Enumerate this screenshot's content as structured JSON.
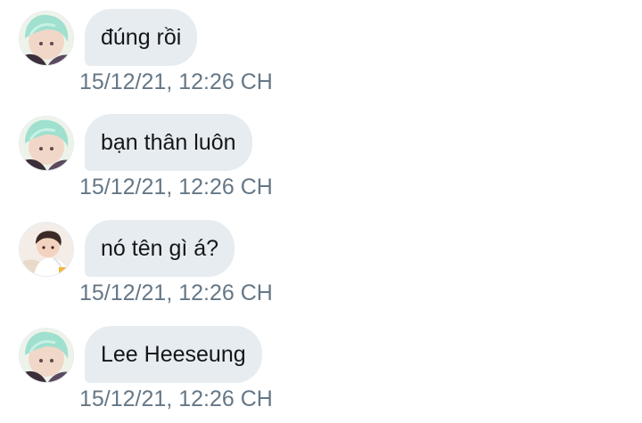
{
  "conversation": {
    "messages": [
      {
        "text": "đúng rồi",
        "timestamp": "15/12/21, 12:26 CH",
        "avatar": "user-green-hair-avatar"
      },
      {
        "text": "bạn thân luôn",
        "timestamp": "15/12/21, 12:26 CH",
        "avatar": "user-green-hair-avatar"
      },
      {
        "text": "nó tên gì á?",
        "timestamp": "15/12/21, 12:26 CH",
        "avatar": "user-dark-hair-avatar"
      },
      {
        "text": "Lee Heeseung",
        "timestamp": "15/12/21, 12:26 CH",
        "avatar": "user-green-hair-avatar"
      }
    ]
  },
  "colors": {
    "bubble_background": "#e6ecf0",
    "message_text": "#14171a",
    "timestamp_text": "#657786",
    "page_background": "#ffffff"
  }
}
